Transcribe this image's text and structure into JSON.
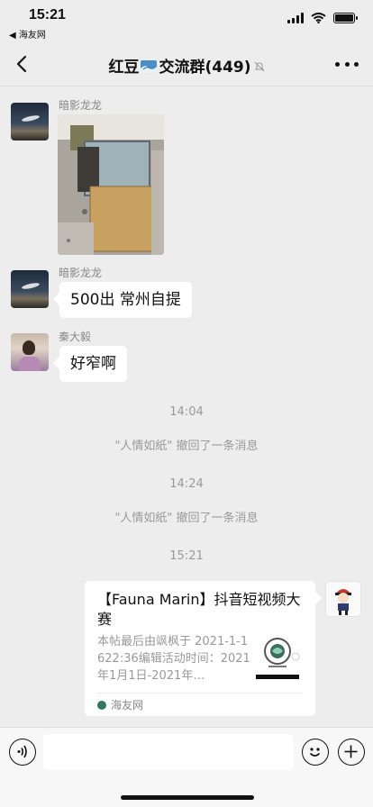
{
  "status_bar": {
    "time": "15:21",
    "back_app": "◀ 海友网",
    "icons": [
      "signal-icon",
      "wifi-icon",
      "battery-icon"
    ]
  },
  "nav": {
    "title_part1": "红豆",
    "title_part2": "交流群",
    "member_count": "(449)",
    "icons": [
      "back-chevron-icon",
      "flag-emoji-icon",
      "mute-icon",
      "more-icon"
    ]
  },
  "messages": [
    {
      "sender": "暗影龙龙",
      "type": "image",
      "avatar": "night-sky-avatar"
    },
    {
      "sender": "暗影龙龙",
      "type": "text",
      "text": "500出  常州自提",
      "avatar": "night-sky-avatar"
    },
    {
      "sender": "秦大毅",
      "type": "text",
      "text": "好窄啊",
      "avatar": "girl-avatar"
    }
  ],
  "system": [
    {
      "time": "14:04",
      "notice": "\"人情如紙\" 撤回了一条消息"
    },
    {
      "time": "14:24",
      "notice": "\"人情如紙\" 撤回了一条消息"
    },
    {
      "time": "15:21"
    }
  ],
  "card": {
    "title": "【Fauna Marin】抖音短视频大赛",
    "description": "本帖最后由飒枫于 2021-1-1622:36编辑活动时间：2021年1月1日-2021年…",
    "source": "海友网"
  },
  "input": {
    "value": "",
    "icons": [
      "voice-icon",
      "emoji-icon",
      "plus-icon"
    ]
  },
  "colors": {
    "background": "#ededed",
    "bubble": "#ffffff",
    "system_text": "#9a9a9a"
  }
}
